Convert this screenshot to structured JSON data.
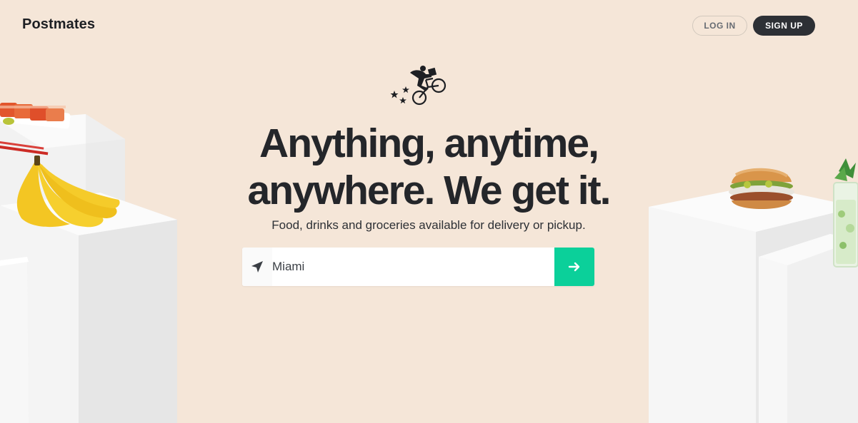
{
  "header": {
    "brand": "Postmates",
    "login_label": "LOG IN",
    "signup_label": "SIGN UP"
  },
  "hero": {
    "headline_line1": "Anything, anytime,",
    "headline_line2": "anywhere. We get it.",
    "subheadline": "Food, drinks and groceries available for delivery or pickup."
  },
  "search": {
    "value": "Miami",
    "placeholder": "Miami",
    "icon": "location-arrow-icon",
    "submit_icon": "arrow-right-icon"
  },
  "colors": {
    "background": "#f5e6d8",
    "primary_dark": "#2d3035",
    "accent": "#0bd09a"
  },
  "illustrations": [
    "sushi-image",
    "bananas-image",
    "burger-image",
    "cocktail-image",
    "courier-logo"
  ]
}
